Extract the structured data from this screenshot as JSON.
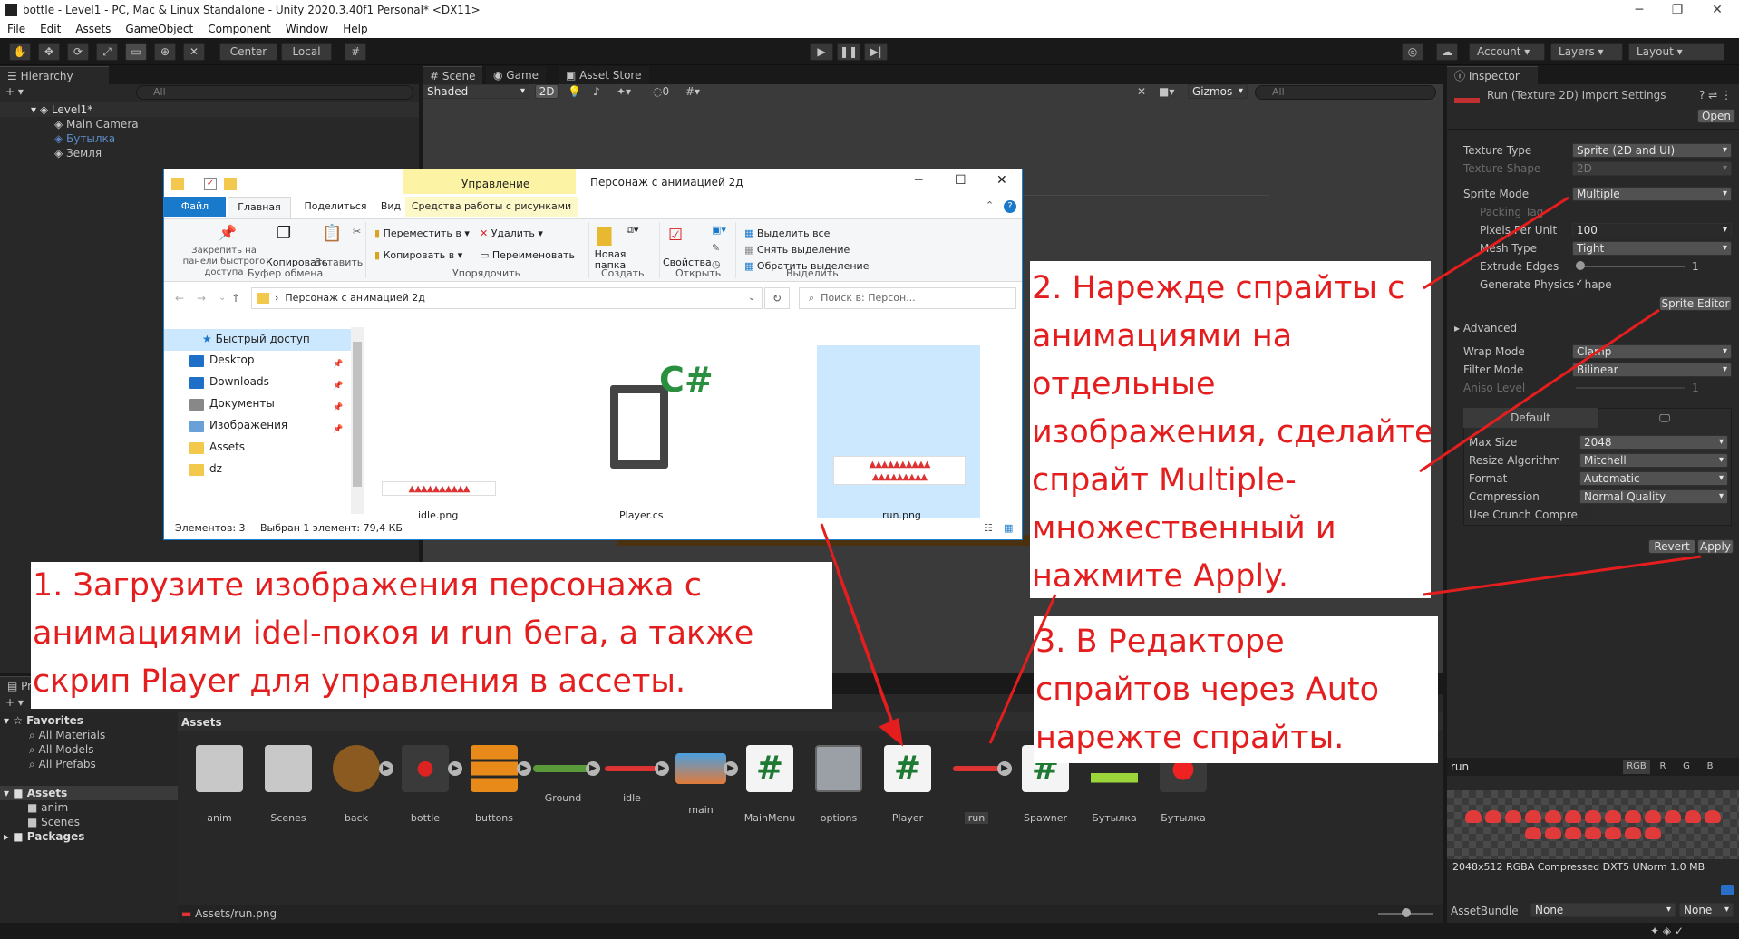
{
  "window": {
    "title": "bottle - Level1 - PC, Mac & Linux Standalone - Unity 2020.3.40f1 Personal* <DX11>",
    "minimize": "─",
    "maximize": "❐",
    "close": "✕"
  },
  "menu": [
    "File",
    "Edit",
    "Assets",
    "GameObject",
    "Component",
    "Window",
    "Help"
  ],
  "toolbar": {
    "center": "Center",
    "local": "Local",
    "account": "Account",
    "layers": "Layers",
    "layout": "Layout"
  },
  "hierarchy": {
    "tab": "Hierarchy",
    "search_placeholder": "All",
    "scene": "Level1*",
    "items": [
      "Main Camera",
      "Бутылка",
      "Земля"
    ]
  },
  "scene_tabs": {
    "scene": "Scene",
    "game": "Game",
    "asset_store": "Asset Store",
    "shading": "Shaded",
    "mode2d": "2D",
    "gizmos": "Gizmos",
    "search_placeholder": "All",
    "hidden_count": "0"
  },
  "inspector": {
    "tab": "Inspector",
    "title": "Run (Texture 2D) Import Settings",
    "open": "Open",
    "fields": [
      {
        "label": "Texture Type",
        "value": "Sprite (2D and UI)"
      },
      {
        "label": "Texture Shape",
        "value": "2D"
      },
      {
        "label": "Sprite Mode",
        "value": "Multiple"
      },
      {
        "label": "Packing Tag",
        "value": ""
      },
      {
        "label": "Pixels Per Unit",
        "value": "100"
      },
      {
        "label": "Mesh Type",
        "value": "Tight"
      },
      {
        "label": "Extrude Edges",
        "value": "1"
      },
      {
        "label": "Generate Physics Shape",
        "value": ""
      }
    ],
    "sprite_editor": "Sprite Editor",
    "advanced": "Advanced",
    "wrap_mode": {
      "label": "Wrap Mode",
      "value": "Clamp"
    },
    "filter_mode": {
      "label": "Filter Mode",
      "value": "Bilinear"
    },
    "aniso": {
      "label": "Aniso Level",
      "value": "1"
    },
    "platform_tab": "Default",
    "platform": [
      {
        "label": "Max Size",
        "value": "2048"
      },
      {
        "label": "Resize Algorithm",
        "value": "Mitchell"
      },
      {
        "label": "Format",
        "value": "Automatic"
      },
      {
        "label": "Compression",
        "value": "Normal Quality"
      },
      {
        "label": "Use Crunch Compression",
        "value": ""
      }
    ],
    "revert": "Revert",
    "apply": "Apply",
    "preview_name": "run",
    "channels": [
      "RGB",
      "R",
      "G",
      "B"
    ],
    "preview_info": "2048x512  RGBA Compressed DXT5 UNorm   1.0 MB",
    "assetbundle_label": "AssetBundle",
    "assetbundle_value": "None",
    "assetbundle_variant": "None"
  },
  "explorer": {
    "title": "Персонаж с анимацией 2д",
    "context_tab": "Управление",
    "ribbon_tabs": [
      "Файл",
      "Главная",
      "Поделиться",
      "Вид",
      "Средства работы с рисунками"
    ],
    "clipboard": [
      "Закрепить на панели быстрого доступа",
      "Копировать",
      "Вставить"
    ],
    "organize": [
      "Переместить в",
      "Копировать в",
      "Удалить",
      "Переименовать"
    ],
    "new": [
      "Новая папка"
    ],
    "open": [
      "Свойства"
    ],
    "select": [
      "Выделить все",
      "Снять выделение",
      "Обратить выделение"
    ],
    "groups": [
      "Буфер обмена",
      "Упорядочить",
      "Создать",
      "Открыть",
      "Выделить"
    ],
    "path": "Персонаж с анимацией 2д",
    "search_placeholder": "Поиск в: Персон...",
    "nav": [
      "Быстрый доступ",
      "Desktop",
      "Downloads",
      "Документы",
      "Изображения",
      "Assets",
      "dz"
    ],
    "files": [
      "idle.png",
      "Player.cs",
      "run.png"
    ],
    "status_count": "Элементов: 3",
    "status_selected": "Выбран 1 элемент: 79,4 КБ"
  },
  "notes": {
    "n1": [
      "1. Загрузите изображения персонажа с",
      "анимациями idel-покоя и run бега, а также",
      "скрип Player для управления в ассеты."
    ],
    "n2": [
      "2. Нарежде спрайты с",
      "анимациями на",
      "отдельные",
      "изображения, сделайте",
      "спрайт Multiple-",
      "множественный и",
      "нажмите Apply."
    ],
    "n3": [
      "3. В Редакторе",
      "спрайтов через Auto",
      "нарежте спрайты."
    ]
  },
  "project": {
    "tab": "Pr",
    "favorites": "Favorites",
    "fav_items": [
      "All Materials",
      "All Models",
      "All Prefabs"
    ],
    "assets": "Assets",
    "asset_folders": [
      "anim",
      "Scenes"
    ],
    "packages": "Packages",
    "breadcrumb": "Assets",
    "assets_list": [
      "anim",
      "Scenes",
      "back",
      "bottle",
      "buttons",
      "Ground",
      "idle",
      "main",
      "MainMenu",
      "options",
      "Player",
      "run",
      "Spawner",
      "Бутылка",
      "Бутылка"
    ],
    "footer_path": "Assets/run.png"
  },
  "colors": {
    "annotation": "#e41e1e",
    "unity_bg": "#282828",
    "accent": "#1883d7"
  }
}
